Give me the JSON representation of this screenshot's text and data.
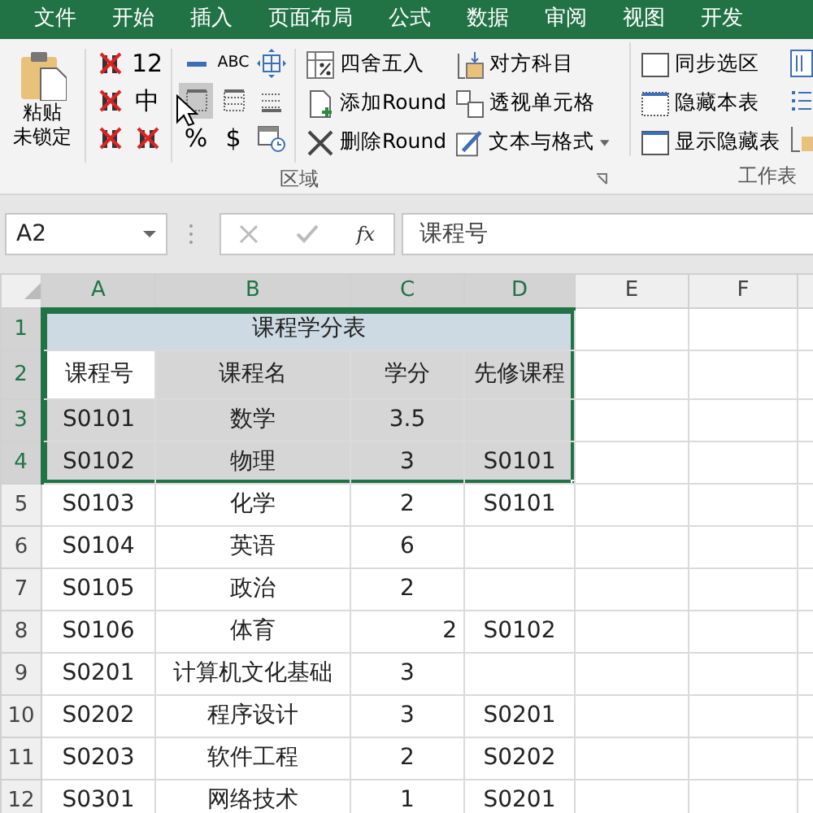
{
  "tabs": [
    {
      "label": "文件"
    },
    {
      "label": "开始"
    },
    {
      "label": "插入"
    },
    {
      "label": "页面布局"
    },
    {
      "label": "公式"
    },
    {
      "label": "数据"
    },
    {
      "label": "审阅"
    },
    {
      "label": "视图"
    },
    {
      "label": "开发"
    }
  ],
  "ribbon": {
    "paste_button": {
      "lines": [
        "粘贴",
        "未锁定"
      ]
    },
    "grid_left": [
      [
        {
          "kind": "icon",
          "hovered": false
        },
        {
          "kind": "text",
          "label": "12",
          "hovered": false
        }
      ],
      [
        {
          "kind": "icon",
          "hovered": false
        },
        {
          "kind": "text",
          "label": "中",
          "hovered": false
        }
      ],
      [
        {
          "kind": "icon",
          "hovered": false
        },
        {
          "kind": "icon",
          "hovered": false
        }
      ]
    ],
    "grid_right": [
      [
        {
          "kind": "icon",
          "hovered": false
        },
        {
          "kind": "text",
          "label": "ABC",
          "hovered": false
        },
        {
          "kind": "icon",
          "hovered": false
        }
      ],
      [
        {
          "kind": "icon",
          "hovered": true
        },
        {
          "kind": "icon",
          "hovered": false
        },
        {
          "kind": "icon",
          "hovered": false
        }
      ],
      [
        {
          "kind": "text",
          "label": "%",
          "hovered": false
        },
        {
          "kind": "text",
          "label": "$",
          "hovered": false
        },
        {
          "kind": "icon",
          "hovered": false
        }
      ]
    ],
    "commands": [
      [
        {
          "label": "四舍五入",
          "dropdown": false
        },
        {
          "label": "添加Round",
          "dropdown": false
        },
        {
          "label": "删除Round",
          "dropdown": false
        }
      ],
      [
        {
          "label": "对方科目",
          "dropdown": false
        },
        {
          "label": "透视单元格",
          "dropdown": false
        },
        {
          "label": "文本与格式",
          "dropdown": true
        }
      ]
    ],
    "sheet_commands": [
      {
        "label": "同步选区"
      },
      {
        "label": "隐藏本表"
      },
      {
        "label": "显示隐藏表"
      }
    ],
    "groups": [
      {
        "label": "区域"
      },
      {
        "label": "工作表"
      }
    ]
  },
  "formula_bar": {
    "name_box": "A2",
    "function_label": "fx",
    "formula": "课程号"
  },
  "sheet": {
    "columns": [
      {
        "label": "A",
        "selected": true
      },
      {
        "label": "B",
        "selected": true
      },
      {
        "label": "C",
        "selected": true
      },
      {
        "label": "D",
        "selected": true
      },
      {
        "label": "E",
        "selected": false
      },
      {
        "label": "F",
        "selected": false
      }
    ],
    "rows": [
      {
        "label": "1",
        "selected": true,
        "title": "课程学分表"
      },
      {
        "label": "2",
        "selected": true,
        "cells": [
          {
            "text": "课程号",
            "active": true
          },
          "课程名",
          "学分",
          "先修课程"
        ]
      },
      {
        "label": "3",
        "selected": true,
        "cells": [
          "S0101",
          "数学",
          "3.5",
          null
        ]
      },
      {
        "label": "4",
        "selected": true,
        "cells": [
          "S0102",
          "物理",
          "3",
          "S0101"
        ]
      },
      {
        "label": "5",
        "selected": false,
        "cells": [
          "S0103",
          "化学",
          "2",
          "S0101"
        ]
      },
      {
        "label": "6",
        "selected": false,
        "cells": [
          "S0104",
          "英语",
          "6",
          null
        ]
      },
      {
        "label": "7",
        "selected": false,
        "cells": [
          "S0105",
          "政治",
          "2",
          null
        ]
      },
      {
        "label": "8",
        "selected": false,
        "cells": [
          "S0106",
          "体育",
          {
            "text": "2",
            "kind": "number"
          },
          "S0102"
        ]
      },
      {
        "label": "9",
        "selected": false,
        "cells": [
          "S0201",
          "计算机文化基础",
          "3",
          null
        ]
      },
      {
        "label": "10",
        "selected": false,
        "cells": [
          "S0202",
          "程序设计",
          "3",
          "S0201"
        ]
      },
      {
        "label": "11",
        "selected": false,
        "cells": [
          "S0203",
          "软件工程",
          "2",
          "S0202"
        ]
      },
      {
        "label": "12",
        "selected": false,
        "cells": [
          "S0301",
          "网络技术",
          "1",
          "S0201"
        ]
      }
    ]
  }
}
